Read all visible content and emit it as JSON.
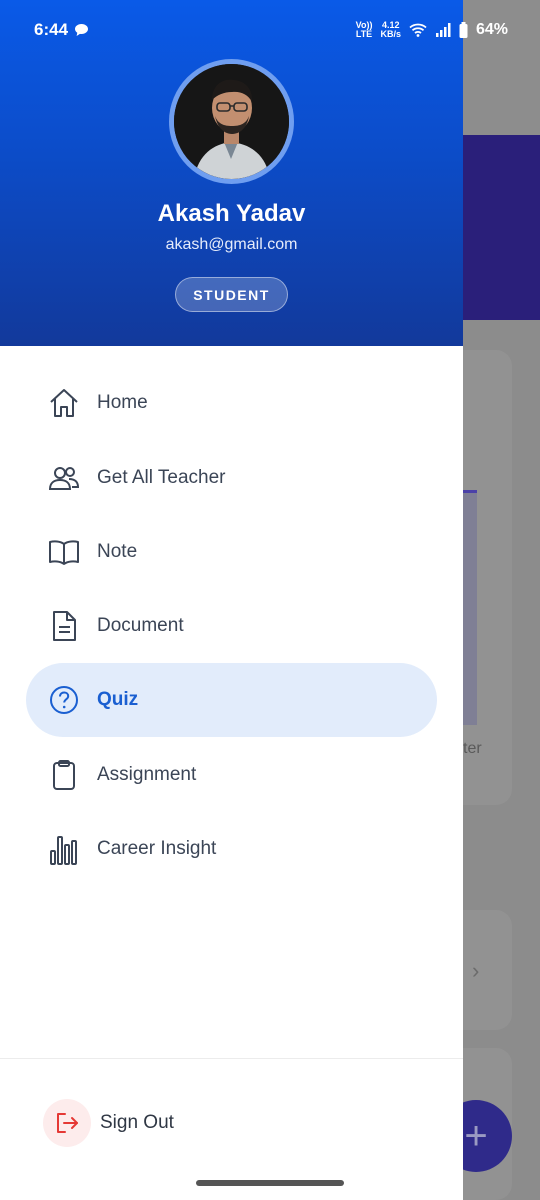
{
  "status_bar": {
    "time": "6:44",
    "network_top": "4.12",
    "network_bottom": "KB/s",
    "lte_top": "Vo))",
    "lte_bottom": "LTE",
    "battery": "64%"
  },
  "profile": {
    "name": "Akash Yadav",
    "email": "akash@gmail.com",
    "role": "STUDENT"
  },
  "menu": [
    {
      "label": "Home",
      "icon": "home-icon",
      "active": false
    },
    {
      "label": "Get All Teacher",
      "icon": "people-icon",
      "active": false
    },
    {
      "label": "Note",
      "icon": "book-icon",
      "active": false
    },
    {
      "label": "Document",
      "icon": "document-icon",
      "active": false
    },
    {
      "label": "Quiz",
      "icon": "question-circle-icon",
      "active": true
    },
    {
      "label": "Assignment",
      "icon": "clipboard-icon",
      "active": false
    },
    {
      "label": "Career Insight",
      "icon": "bar-chart-icon",
      "active": false
    }
  ],
  "signout": {
    "label": "Sign Out",
    "icon": "logout-icon"
  },
  "background": {
    "partial_text": "ter",
    "fab_label": "+"
  },
  "colors": {
    "accent": "#1a5fd1",
    "header_start": "#0a5ae8",
    "header_end": "#12399b",
    "danger": "#e53935"
  }
}
